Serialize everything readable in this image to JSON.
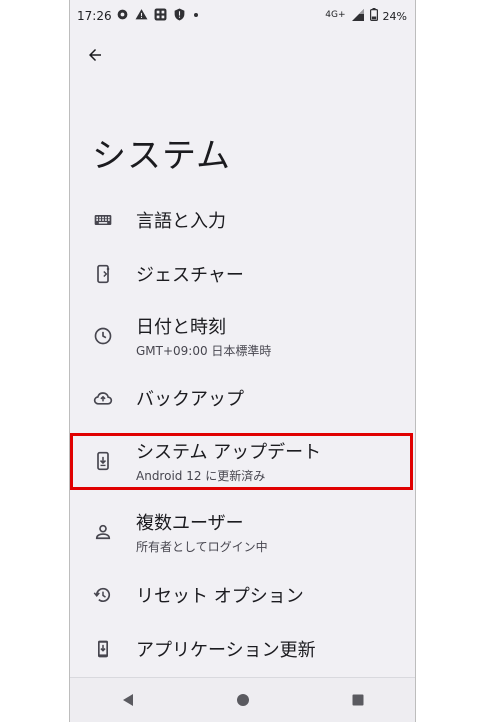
{
  "status_bar": {
    "time": "17:26",
    "network": "4G+",
    "battery": "24%",
    "icons_left": [
      "settings-gear-icon",
      "warning-icon",
      "app-grid-icon",
      "shield-alert-icon",
      "dot-icon"
    ]
  },
  "page": {
    "title": "システム"
  },
  "items": [
    {
      "title": "言語と入力",
      "subtitle": "",
      "icon": "keyboard-icon"
    },
    {
      "title": "ジェスチャー",
      "subtitle": "",
      "icon": "gesture-phone-icon"
    },
    {
      "title": "日付と時刻",
      "subtitle": "GMT+09:00 日本標準時",
      "icon": "clock-icon"
    },
    {
      "title": "バックアップ",
      "subtitle": "",
      "icon": "cloud-upload-icon"
    },
    {
      "title": "システム アップデート",
      "subtitle": "Android 12 に更新済み",
      "icon": "system-update-icon"
    },
    {
      "title": "複数ユーザー",
      "subtitle": "所有者としてログイン中",
      "icon": "person-icon"
    },
    {
      "title": "リセット オプション",
      "subtitle": "",
      "icon": "history-icon"
    },
    {
      "title": "アプリケーション更新",
      "subtitle": "",
      "icon": "app-update-icon"
    }
  ],
  "colors": {
    "background": "#f1f0f4",
    "highlight_border": "#e00000",
    "text_primary": "#1b1b1f",
    "text_secondary": "#47464f"
  }
}
